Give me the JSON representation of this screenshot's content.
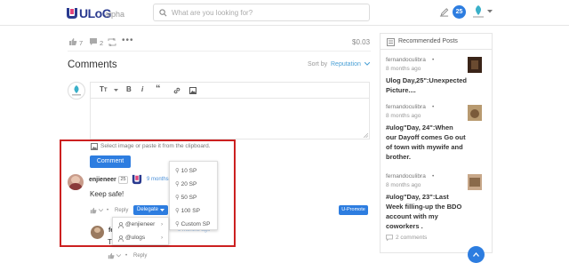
{
  "header": {
    "logo": "ULoG",
    "logo_suffix": "alpha",
    "search_placeholder": "What are you looking for?",
    "notification_count": "25"
  },
  "post_actions": {
    "likes": "7",
    "comments": "2",
    "payout": "$0.03"
  },
  "comments_section": {
    "title": "Comments",
    "sort_label": "Sort by",
    "sort_value": "Reputation",
    "image_hint": "Select image or paste it from the clipboard.",
    "submit_label": "Comment"
  },
  "comment": {
    "author": "enjieneer",
    "reputation": "25",
    "time": "9 months",
    "body": "Keep safe!",
    "reply_label": "Reply",
    "delegate_label": "Delegate",
    "upromote_label": "U-Promote"
  },
  "delegate_menu": {
    "options": [
      "10 SP",
      "20 SP",
      "50 SP",
      "100 SP",
      "Custom SP"
    ]
  },
  "user_menu": {
    "options": [
      "@enjieneer",
      "@ulogs"
    ]
  },
  "nested_comment": {
    "author_partial": "fe",
    "body_partial": "Th",
    "time": "9 months ago",
    "reply_label": "Reply"
  },
  "sidebar": {
    "title": "Recommended Posts",
    "posts": [
      {
        "author": "fernandoculibra",
        "time": "8 months ago",
        "title_lines": [
          "Ulog Day,25\":Unexpected",
          "Picture...."
        ]
      },
      {
        "author": "fernandoculibra",
        "time": "8 months ago",
        "title_lines": [
          "#ulog\"Day, 24\":When",
          "our Dayoff comes Go out",
          "of town with mywife and",
          "brother."
        ]
      },
      {
        "author": "fernandoculibra",
        "time": "8 months ago",
        "title_lines": [
          "#ulog\"Day, 23\":Last",
          "Week filling-up the BDO",
          "account with my",
          "coworkers ."
        ]
      }
    ],
    "comments_count": "2 comments"
  },
  "colors": {
    "accent": "#2d7de0",
    "highlight": "#cc2020",
    "link": "#4a90d9"
  }
}
